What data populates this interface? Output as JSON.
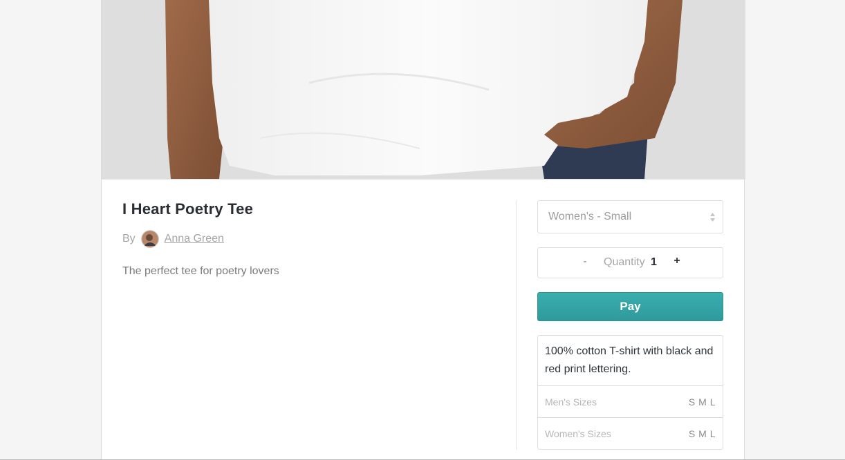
{
  "product": {
    "title": "I Heart Poetry Tee",
    "by_label": "By",
    "author": "Anna Green",
    "description": "The perfect tee for poetry lovers"
  },
  "purchase": {
    "size_select": {
      "selected": "Women's - Small"
    },
    "quantity": {
      "minus": "-",
      "label": "Quantity",
      "value": "1",
      "plus": "+"
    },
    "pay_label": "Pay",
    "pay_color": "#35a3a5"
  },
  "details": {
    "text": "100% cotton T-shirt with black and red print lettering.",
    "sizes": [
      {
        "label": "Men's Sizes",
        "values": "S M L"
      },
      {
        "label": "Women's Sizes",
        "values": "S M L"
      }
    ]
  },
  "icons": {
    "select_arrows": "sort-arrows-icon",
    "avatar": "author-avatar"
  }
}
